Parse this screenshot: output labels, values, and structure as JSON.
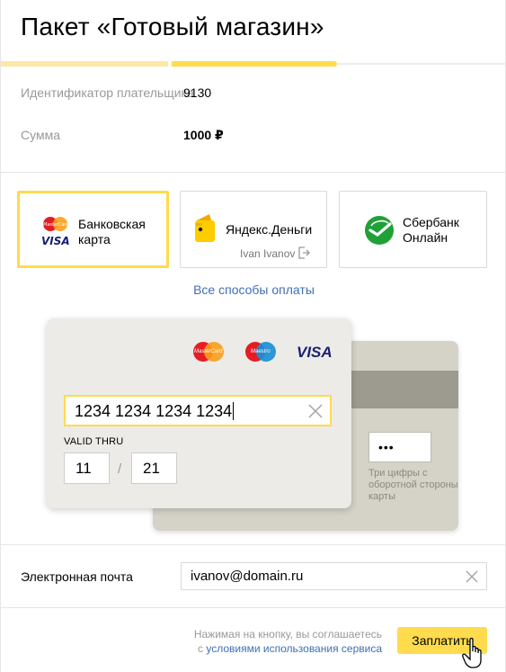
{
  "header": {
    "title": "Пакет «Готовый магазин»"
  },
  "progress": {
    "steps_total": 3,
    "current_step": 2
  },
  "payer": {
    "id_label": "Идентификатор плательщика",
    "id_value": "9130",
    "sum_label": "Сумма",
    "sum_value": "1000 ₽"
  },
  "methods": [
    {
      "label_line1": "Банковская",
      "label_line2": "карта",
      "icon": "mastercard-visa-icon",
      "selected": true
    },
    {
      "label_line1": "Яндекс.Деньги",
      "account": "Ivan Ivanov",
      "icon": "yandex-money-wallet-icon",
      "selected": false
    },
    {
      "label_line1": "Сбербанк",
      "label_line2": "Онлайн",
      "icon": "sberbank-logo-icon",
      "selected": false
    }
  ],
  "all_methods_link": "Все способы оплаты",
  "card": {
    "brands": [
      "MasterCard",
      "Maestro",
      "VISA"
    ],
    "number": "1234 1234 1234 1234",
    "valid_thru_label": "VALID THRU",
    "month": "11",
    "date_separator": "/",
    "year": "21",
    "cvc_masked": "•••",
    "cvc_hint": "Три цифры с оборотной стороны карты"
  },
  "email": {
    "label": "Электронная почта",
    "value": "ivanov@domain.ru"
  },
  "footer": {
    "terms_text": "Нажимая на кнопку, вы соглашаетесь",
    "terms_prefix": "с ",
    "terms_link": "условиями использования сервиса",
    "pay_button": "Заплатить"
  },
  "colors": {
    "accent": "#ffdb4d",
    "link": "#3f6fb5",
    "muted": "#999999"
  }
}
